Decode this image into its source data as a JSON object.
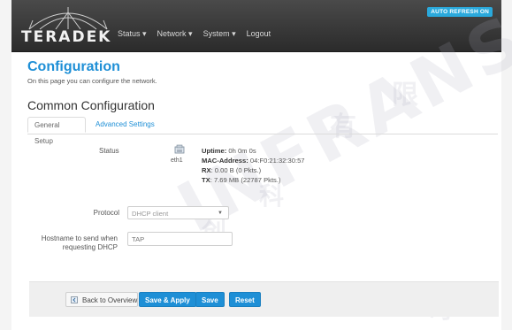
{
  "header": {
    "logo_text": "TERADEK",
    "nav": [
      "Status ▾",
      "Network ▾",
      "System ▾",
      "Logout"
    ],
    "auto_refresh": "AUTO REFRESH ON"
  },
  "page": {
    "title": "Configuration",
    "description": "On this page you can configure the network."
  },
  "section": {
    "title": "Common Configuration",
    "tabs": [
      "General Setup",
      "Advanced Settings"
    ]
  },
  "status": {
    "label": "Status",
    "interface": "eth1",
    "uptime_label": "Uptime:",
    "uptime_value": "0h 0m 0s",
    "mac_label": "MAC-Address:",
    "mac_value": "04:F0:21:32:30:57",
    "rx_label": "RX",
    "rx_value": ": 0.00 B (0 Pkts.)",
    "tx_label": "TX",
    "tx_value": ": 7.69 MB (22787 Pkts.)"
  },
  "form": {
    "protocol_label": "Protocol",
    "protocol_value": "DHCP client",
    "hostname_label_line1": "Hostname to send when",
    "hostname_label_line2": "requesting DHCP",
    "hostname_placeholder": "TAP"
  },
  "footer": {
    "back_label": "Back to Overview",
    "save_apply_label": "Save & Apply",
    "save_label": "Save",
    "reset_label": "Reset"
  },
  "watermark": {
    "text": "INFRANS",
    "chars": [
      "有",
      "限",
      "创",
      "科",
      "司"
    ]
  }
}
